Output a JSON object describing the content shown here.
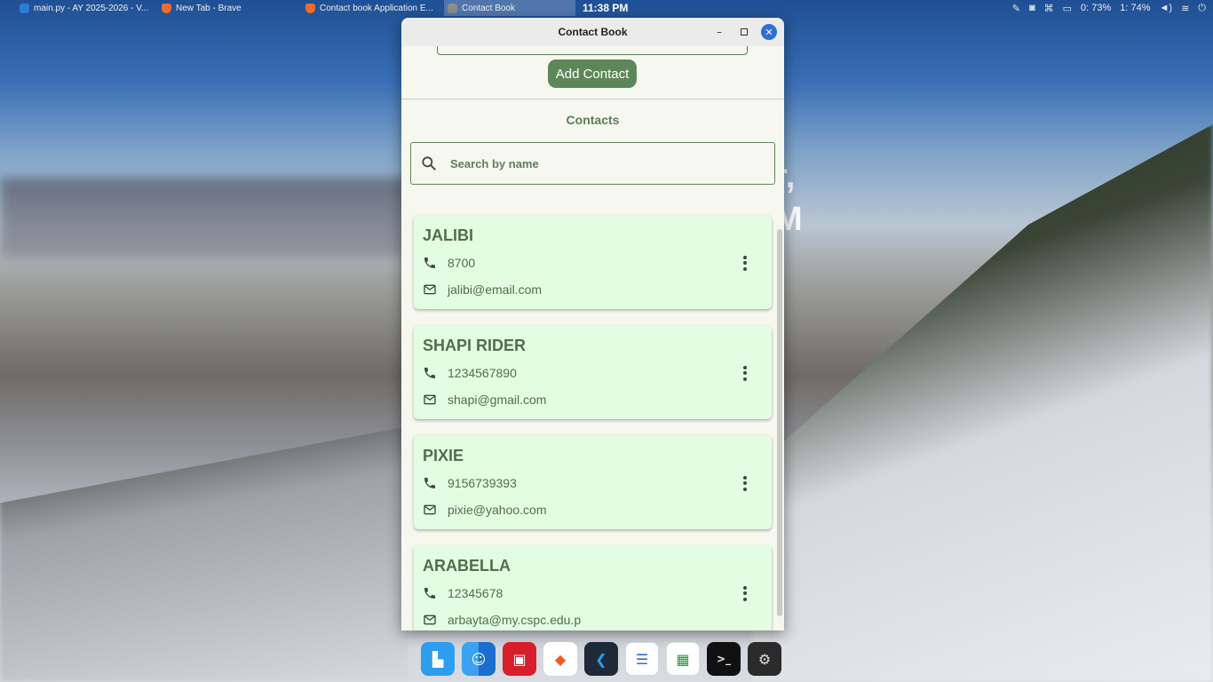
{
  "taskbar": {
    "tabs": [
      {
        "label": "main.py - AY 2025-2026 - V...",
        "icon": "vscode-icon"
      },
      {
        "label": "New Tab - Brave",
        "icon": "brave-icon"
      },
      {
        "label": "Contact book Application E...",
        "icon": "brave-icon"
      },
      {
        "label": "Contact Book",
        "icon": "app-icon"
      }
    ],
    "clock": "11:38 PM",
    "battery_0": "0: 73%",
    "battery_1": "1: 74%"
  },
  "background": {
    "headline_1": "r,",
    "headline_2": "M"
  },
  "window": {
    "title": "Contact Book",
    "add_button": "Add Contact",
    "contacts_heading": "Contacts",
    "search_placeholder": "Search by name",
    "contacts": [
      {
        "name": "JALIBI",
        "phone": "8700",
        "email": "jalibi@email.com"
      },
      {
        "name": "SHAPI RIDER",
        "phone": "1234567890",
        "email": "shapi@gmail.com"
      },
      {
        "name": "PIXIE",
        "phone": "9156739393",
        "email": "pixie@yahoo.com"
      },
      {
        "name": "ARABELLA",
        "phone": "12345678",
        "email": "arbayta@my.cspc.edu.p"
      }
    ]
  },
  "dock": {
    "apps": [
      "launcher-icon",
      "finder-icon",
      "photo-booth-icon",
      "brave-icon",
      "vscode-icon",
      "text-editor-icon",
      "spreadsheet-icon",
      "terminal-icon",
      "settings-icon"
    ]
  },
  "colors": {
    "accent": "#5e8759",
    "card_bg": "#e2fde2",
    "text_green": "#4f6f4d",
    "window_bg": "#f6f8ef",
    "close_blue": "#2f6fd3"
  }
}
